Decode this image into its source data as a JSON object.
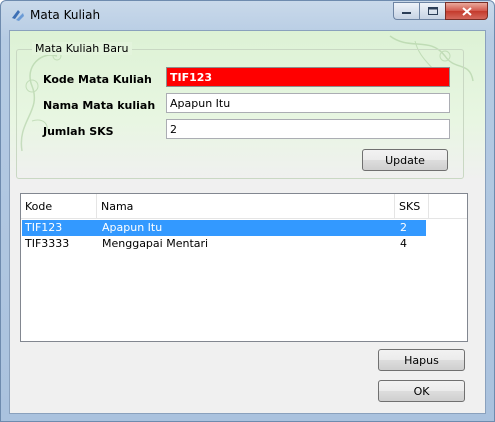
{
  "window": {
    "title": "Mata Kuliah",
    "icon": "app-icon",
    "controls": {
      "minimize_icon": "minimize-icon",
      "maximize_icon": "maximize-icon",
      "close_icon": "close-icon"
    }
  },
  "form": {
    "group_title": "Mata Kuliah Baru",
    "kode": {
      "label": "Kode Mata Kuliah",
      "value": "TIF123"
    },
    "nama": {
      "label": "Nama Mata kuliah",
      "value": "Apapun Itu"
    },
    "sks": {
      "label": "Jumlah SKS",
      "value": "2"
    },
    "update_label": "Update"
  },
  "table": {
    "columns": [
      "Kode",
      "Nama",
      "SKS"
    ],
    "rows": [
      {
        "kode": "TIF123",
        "nama": "Apapun Itu",
        "sks": "2",
        "selected": true
      },
      {
        "kode": "TIF3333",
        "nama": "Menggapai Mentari",
        "sks": "4",
        "selected": false
      }
    ]
  },
  "actions": {
    "hapus_label": "Hapus",
    "ok_label": "OK"
  },
  "colors": {
    "selected_row": "#3399ff",
    "focused_field": "#ff0000"
  }
}
